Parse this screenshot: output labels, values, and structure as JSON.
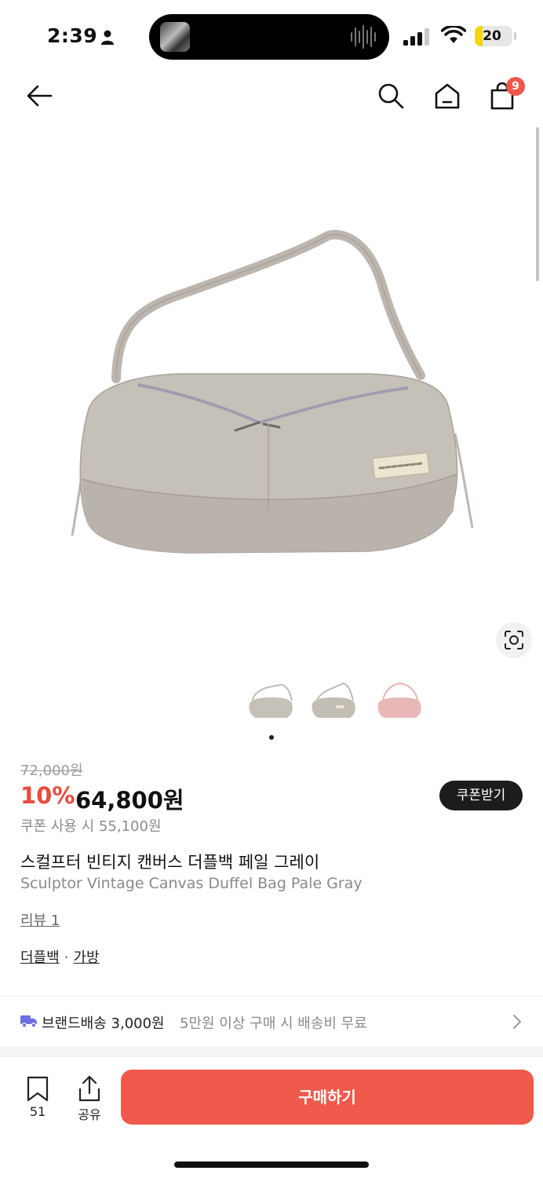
{
  "status_bar": {
    "time": "2:39",
    "battery": "20",
    "battery_level": 0.2
  },
  "nav": {
    "cart_count": "9"
  },
  "gallery": {
    "thumbnails": [
      "gray-bag-front",
      "gray-bag-angle",
      "pink-bag-front"
    ],
    "current_index": 1,
    "total_pages": 1
  },
  "product": {
    "original_price": "72,000원",
    "discount": "10%",
    "price": "64,800원",
    "coupon_price": "쿠폰 사용 시 55,100원",
    "coupon_button": "쿠폰받기",
    "name_ko": "스컬프터 빈티지 캔버스 더플백 페일 그레이",
    "name_en": "Sculptor Vintage Canvas Duffel Bag Pale Gray",
    "review_link": "리뷰 1",
    "category_1": "더플백",
    "separator": "·",
    "category_2": "가방"
  },
  "shipping": {
    "label": "브랜드배송 3,000원",
    "note": "5만원 이상 구매 시 배송비 무료"
  },
  "bottom_bar": {
    "save_count": "51",
    "share_label": "공유",
    "buy_label": "구매하기"
  },
  "colors": {
    "accent": "#ef5a4c",
    "discount": "#ea4a3c",
    "badge": "#f0574a",
    "battery": "#f5d60b",
    "truck": "#6b6fe0"
  }
}
